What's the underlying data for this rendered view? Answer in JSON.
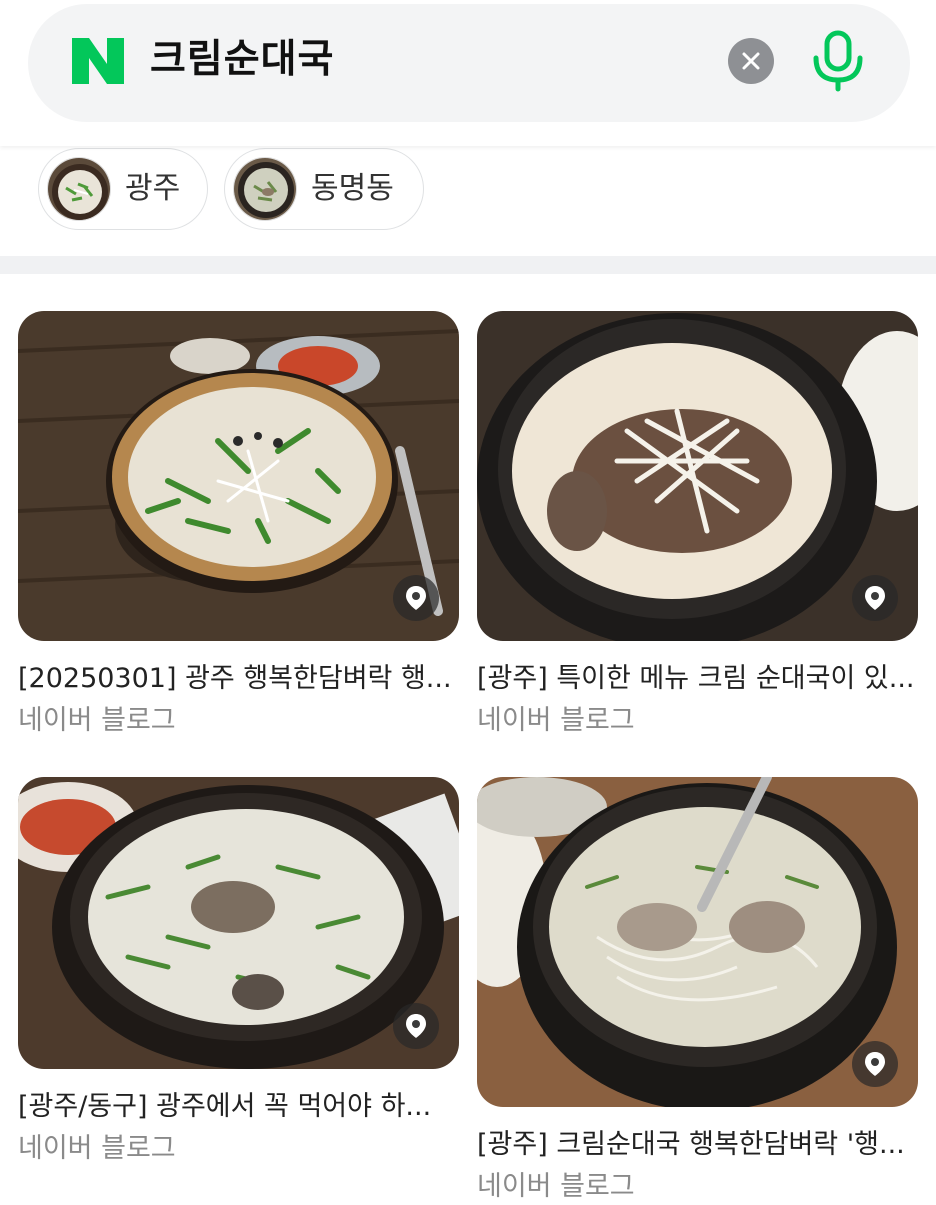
{
  "search": {
    "query": "크림순대국"
  },
  "colors": {
    "brand_green": "#03c75a",
    "clear_gray": "#8e9094",
    "search_bg": "#f3f4f5"
  },
  "icons": {
    "logo": "naver-n-logo",
    "clear": "close-icon",
    "mic": "microphone-icon",
    "pin": "location-pin-icon"
  },
  "filters": [
    {
      "label": "광주"
    },
    {
      "label": "동명동"
    }
  ],
  "results": [
    {
      "title": "[20250301] 광주 행복한담벼락 행...",
      "source": "네이버 블로그"
    },
    {
      "title": "[광주] 특이한 메뉴 크림 순대국이 있...",
      "source": "네이버 블로그"
    },
    {
      "title": "[광주/동구] 광주에서 꼭 먹어야 하...",
      "source": "네이버 블로그"
    },
    {
      "title": "[광주] 크림순대국 행복한담벼락 '행...",
      "source": "네이버 블로그"
    }
  ]
}
